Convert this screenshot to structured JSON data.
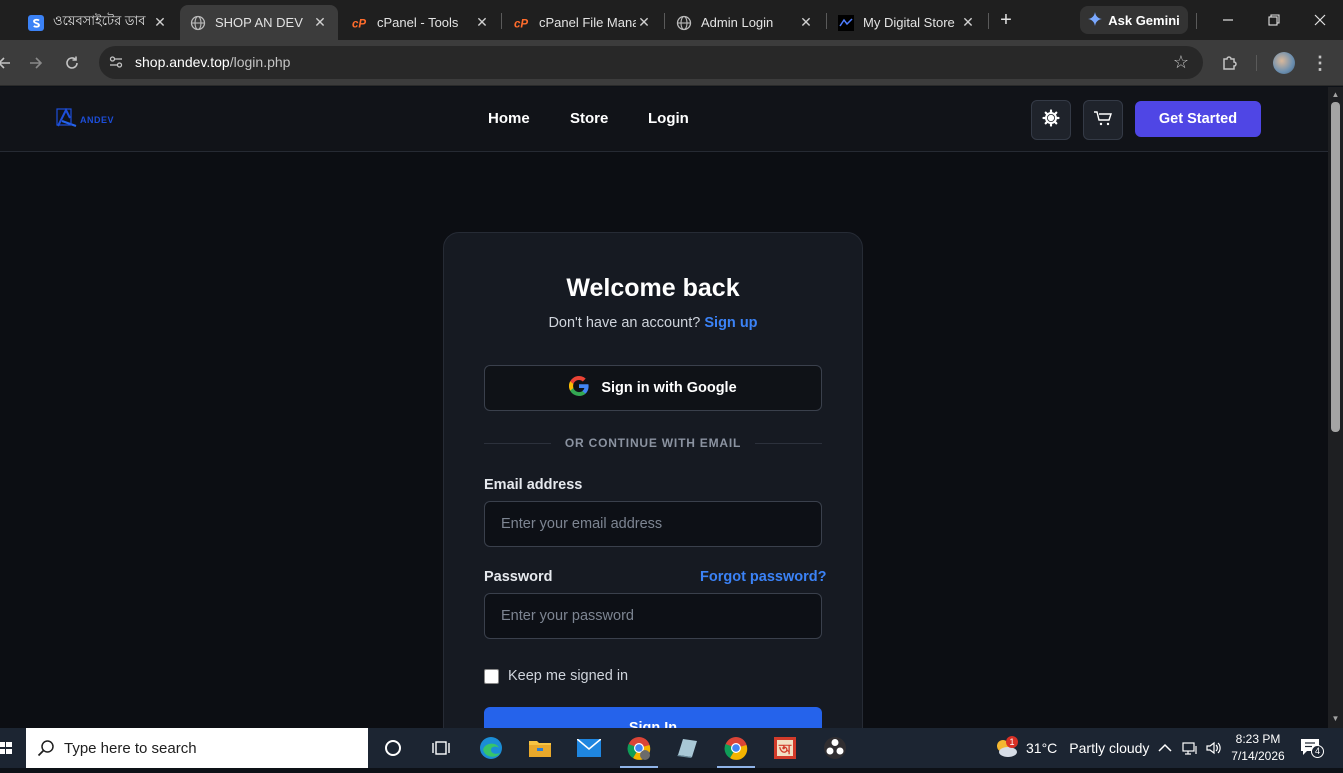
{
  "browser": {
    "tabs": [
      {
        "title": "ওয়েবসাইটের ডাব",
        "icon": "stripe-s-icon",
        "active": false
      },
      {
        "title": "SHOP AN DEV",
        "icon": "globe-icon",
        "active": true
      },
      {
        "title": "cPanel - Tools",
        "icon": "cpanel-icon",
        "active": false
      },
      {
        "title": "cPanel File Mana",
        "icon": "cpanel-icon",
        "active": false
      },
      {
        "title": "Admin Login",
        "icon": "globe-icon",
        "active": false
      },
      {
        "title": "My Digital Store",
        "icon": "store-favicon-icon",
        "active": false
      }
    ],
    "ask_gemini": "Ask Gemini",
    "url_domain": "shop.andev.top",
    "url_path": "/login.php"
  },
  "site": {
    "logo_text": "ANDEV",
    "nav": {
      "home": "Home",
      "store": "Store",
      "login": "Login"
    },
    "cta": "Get Started",
    "accent": "#4f46e5"
  },
  "login": {
    "title": "Welcome back",
    "no_account": "Don't have an account?",
    "signup": "Sign up",
    "google": "Sign in with Google",
    "divider": "OR CONTINUE WITH EMAIL",
    "email_label": "Email address",
    "email_placeholder": "Enter your email address",
    "password_label": "Password",
    "forgot": "Forgot password?",
    "password_placeholder": "Enter your password",
    "remember": "Keep me signed in",
    "submit": "Sign In",
    "link_color": "#3b82f6"
  },
  "taskbar": {
    "search_placeholder": "Type here to search",
    "weather_temp": "31°C",
    "weather_desc": "Partly cloudy",
    "weather_badge": "1",
    "time": "8:23 PM",
    "date": "7/14/2026",
    "notifications": "4"
  }
}
